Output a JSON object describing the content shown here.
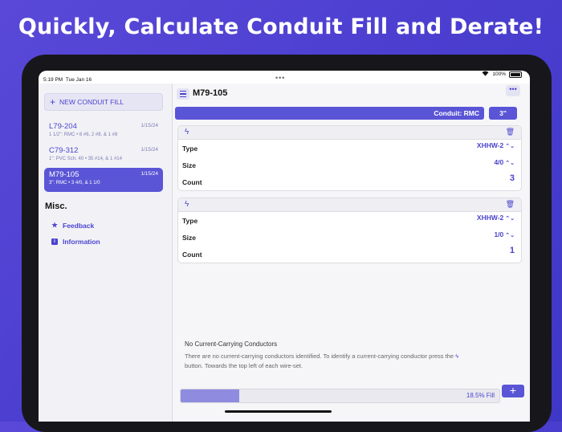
{
  "headline": "Quickly, Calculate Conduit Fill and Derate!",
  "status": {
    "time": "5:19 PM",
    "date": "Tue Jan 16",
    "wifi_icon": "wifi-icon",
    "battery": "100%"
  },
  "sidebar": {
    "new_button": "NEW CONDUIT FILL",
    "items": [
      {
        "title": "L79-204",
        "date": "1/15/24",
        "subtitle": "1 1/2\": RMC • 8 #6, 2 #8, & 1 #8"
      },
      {
        "title": "C79-312",
        "date": "1/15/24",
        "subtitle": "1\": PVC Sch. 40 • 35 #14, & 1 #14"
      },
      {
        "title": "M79-105",
        "date": "1/15/24",
        "subtitle": "3\": RMC • 3 4/0, & 1 1/0",
        "selected": true
      }
    ],
    "misc_heading": "Misc.",
    "nav": [
      {
        "label": "Feedback",
        "icon": "star-icon"
      },
      {
        "label": "Information",
        "icon": "info-icon"
      }
    ]
  },
  "main": {
    "title": "M79-105",
    "conduit_label": "Conduit: RMC",
    "conduit_size": "3\"",
    "wire_sets": [
      {
        "type_label": "Type",
        "type": "XHHW-2",
        "size_label": "Size",
        "size": "4/0",
        "count_label": "Count",
        "count": "3"
      },
      {
        "type_label": "Type",
        "type": "XHHW-2",
        "size_label": "Size",
        "size": "1/0",
        "count_label": "Count",
        "count": "1"
      }
    ],
    "nccc_title": "No Current-Carrying Conductors",
    "nccc_text": "There are no current-carrying conductors identified. To identify a current-carrying conductor press the",
    "nccc_text2": "button. Towards the top left of each wire-set.",
    "fill_label": "18.5% Fill",
    "fill_fraction": 0.185,
    "add_label": "+"
  },
  "colors": {
    "accent": "#5a55d6",
    "background": "#4c3fd0"
  }
}
